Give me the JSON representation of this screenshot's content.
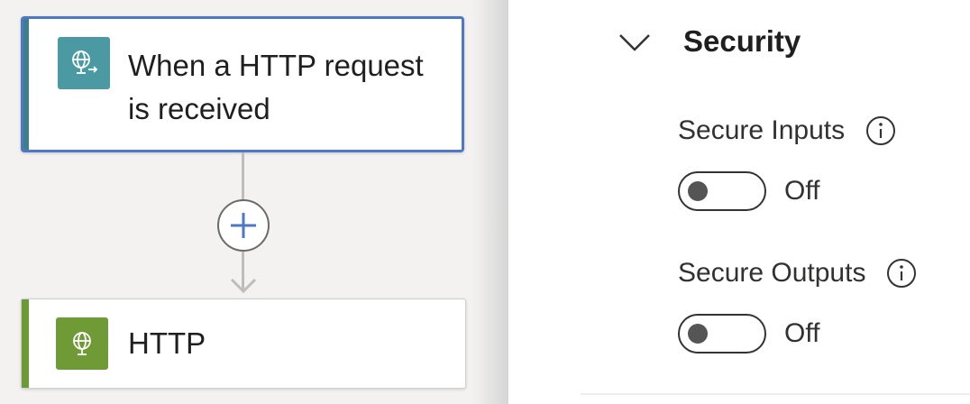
{
  "workflow": {
    "trigger": {
      "title": "When a HTTP request is received",
      "icon": "http-request-trigger-icon",
      "color": "#4a99a3"
    },
    "add_step": {
      "icon": "plus-icon"
    },
    "action": {
      "title": "HTTP",
      "icon": "globe-icon",
      "color": "#6f9a35"
    }
  },
  "settings": {
    "section": {
      "title": "Security",
      "expanded": true
    },
    "secure_inputs": {
      "label": "Secure Inputs",
      "state": "Off"
    },
    "secure_outputs": {
      "label": "Secure Outputs",
      "state": "Off"
    }
  },
  "colors": {
    "selected_border": "#4f78c4",
    "plus_accent": "#4f78c4"
  }
}
